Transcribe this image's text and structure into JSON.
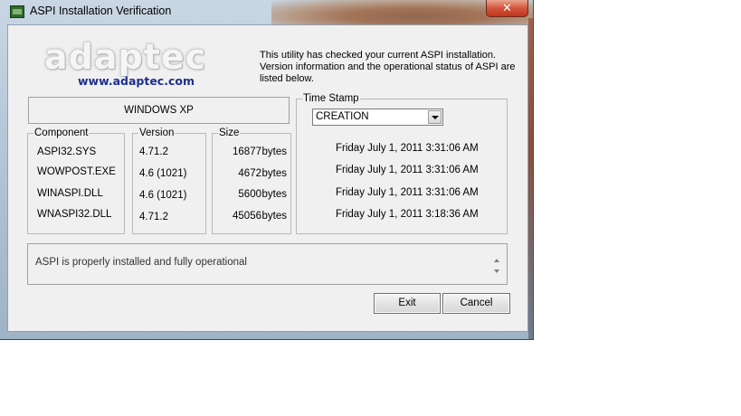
{
  "window": {
    "title": "ASPI Installation Verification",
    "close_glyph": "✕"
  },
  "logo": {
    "word": "adaptec",
    "url": "www.adaptec.com"
  },
  "intro": "This utility has checked your current ASPI installation. Version information and the operational status of ASPI are listed below.",
  "os": "WINDOWS XP",
  "components": {
    "group_title": "Component",
    "items": [
      "ASPI32.SYS",
      "WOWPOST.EXE",
      "WINASPI.DLL",
      "WNASPI32.DLL"
    ]
  },
  "versions": {
    "group_title": "Version",
    "items": [
      "4.71.2",
      "4.6 (1021)",
      "4.6 (1021)",
      "4.71.2"
    ]
  },
  "sizes": {
    "group_title": "Size",
    "items": [
      "16877",
      "4672",
      "5600",
      "45056"
    ],
    "unit": "bytes"
  },
  "timestamp": {
    "group_title": "Time Stamp",
    "selected": "CREATION",
    "items": [
      "Friday July 1, 2011 3:31:06 AM",
      "Friday July 1, 2011 3:31:06 AM",
      "Friday July 1, 2011 3:31:06 AM",
      "Friday July 1, 2011 3:18:36 AM"
    ]
  },
  "status": "ASPI is properly installed and fully operational",
  "buttons": {
    "exit": "Exit",
    "cancel": "Cancel"
  }
}
